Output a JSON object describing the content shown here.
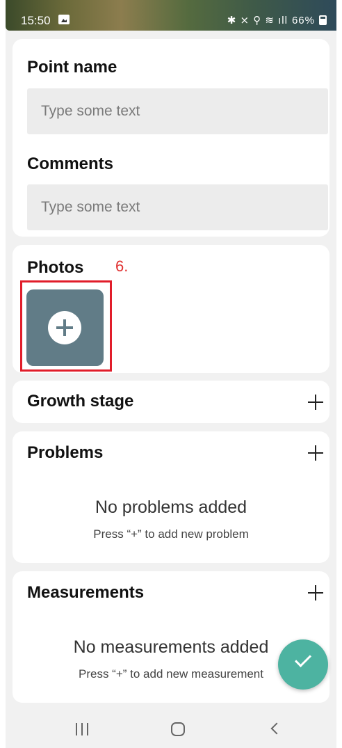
{
  "status_bar": {
    "time": "15:50",
    "indicators": "✱ ⨯ ⚲ ≋ ıll",
    "battery": "66%"
  },
  "point_name": {
    "label": "Point name",
    "placeholder": "Type some text"
  },
  "comments": {
    "label": "Comments",
    "placeholder": "Type some text"
  },
  "photos": {
    "label": "Photos",
    "annotation": "6."
  },
  "growth_stage": {
    "label": "Growth stage"
  },
  "problems": {
    "label": "Problems",
    "empty_title": "No problems added",
    "empty_hint": "Press “+” to add new problem"
  },
  "measurements": {
    "label": "Measurements",
    "empty_title": "No measurements added",
    "empty_hint": "Press “+” to add new measurement"
  },
  "colors": {
    "accent": "#4db3a1",
    "photo_button": "#617c87",
    "annotation": "#e11d2a"
  },
  "icons": {
    "add_photo": "plus-circle-icon",
    "section_add": "plus-icon",
    "confirm": "check-icon"
  }
}
